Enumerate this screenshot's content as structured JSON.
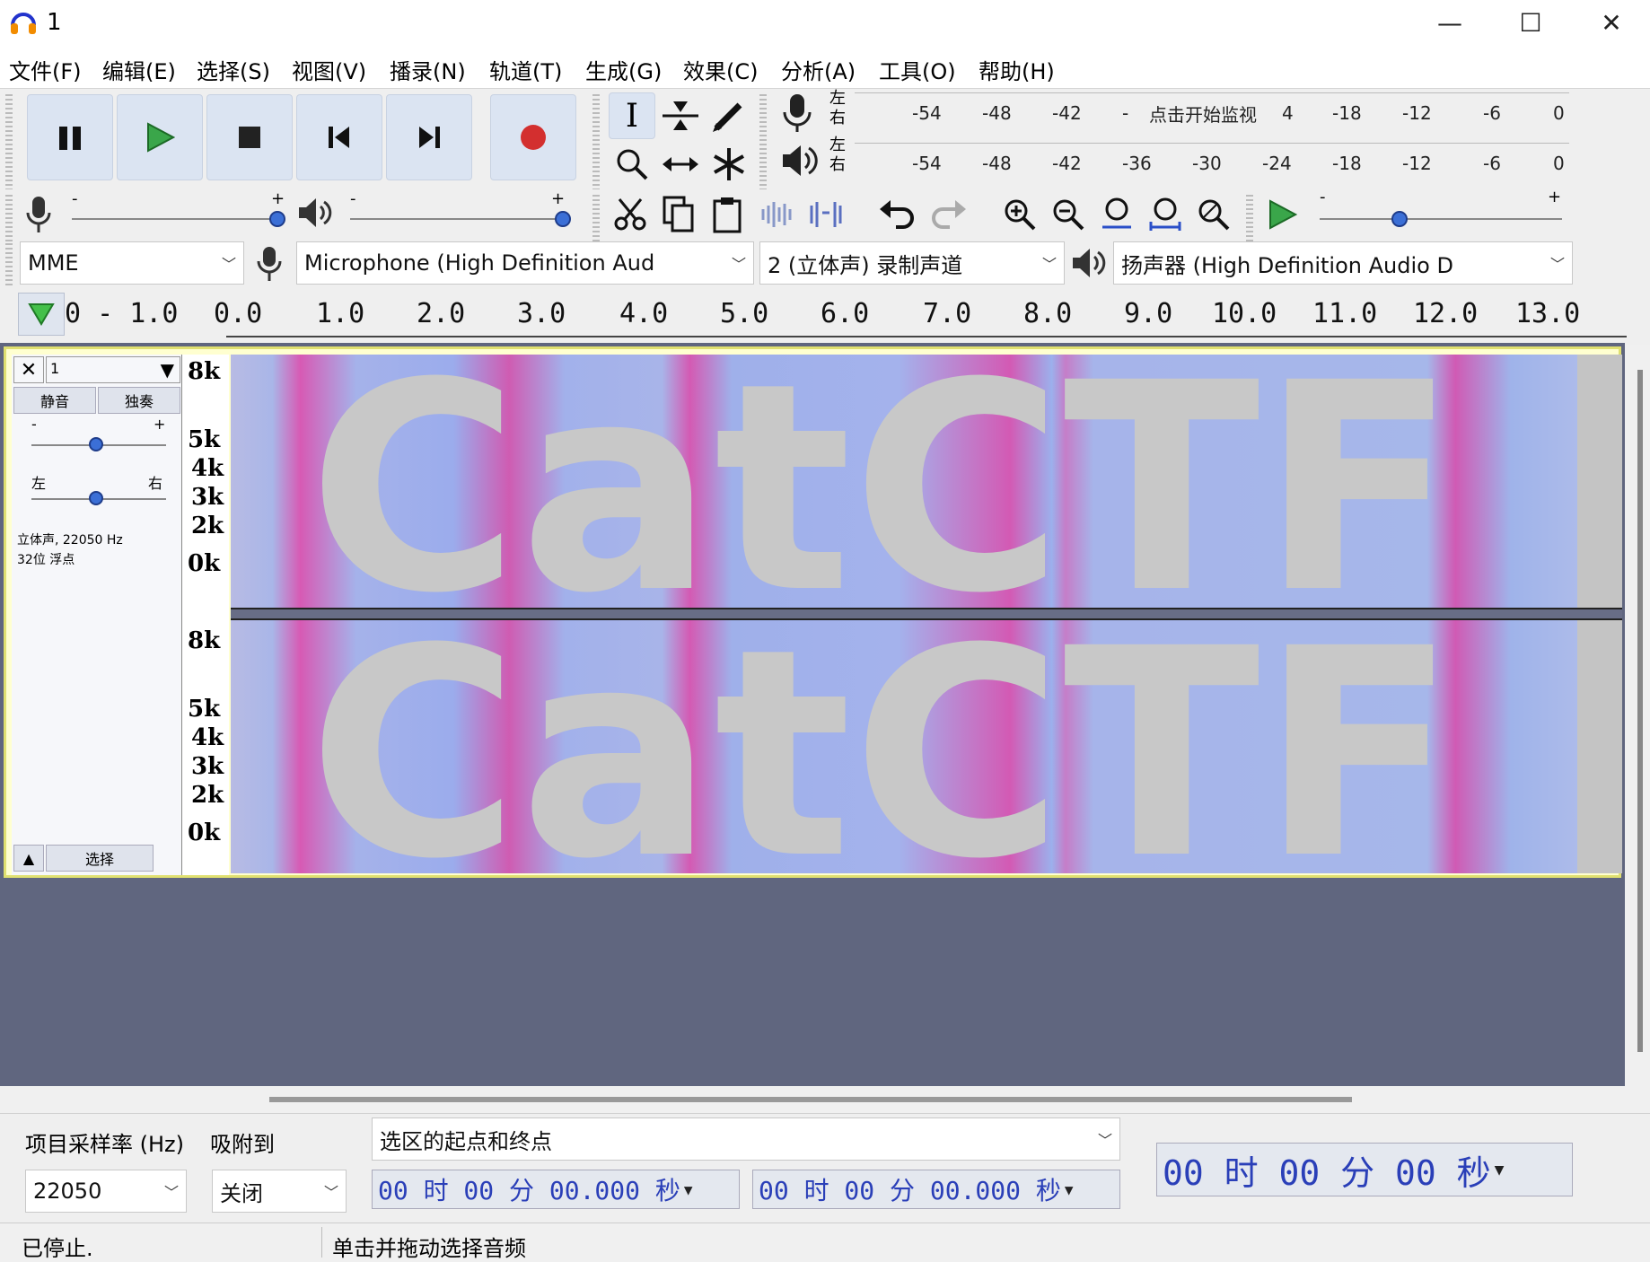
{
  "window": {
    "title": "1",
    "min": "—",
    "max": "☐",
    "close": "✕"
  },
  "menu": [
    {
      "label": "文件(F)"
    },
    {
      "label": "编辑(E)"
    },
    {
      "label": "选择(S)"
    },
    {
      "label": "视图(V)"
    },
    {
      "label": "播录(N)"
    },
    {
      "label": "轨道(T)"
    },
    {
      "label": "生成(G)"
    },
    {
      "label": "效果(C)"
    },
    {
      "label": "分析(A)"
    },
    {
      "label": "工具(O)"
    },
    {
      "label": "帮助(H)"
    }
  ],
  "meter": {
    "lr_left": "左",
    "lr_right": "右",
    "record_ticks": [
      "-54",
      "-48",
      "-42",
      "-",
      "点击开始监视",
      "4",
      "-18",
      "-12",
      "-6",
      "0"
    ],
    "play_ticks": [
      "-54",
      "-48",
      "-42",
      "-36",
      "-30",
      "-24",
      "-18",
      "-12",
      "-6",
      "0"
    ]
  },
  "sliders": {
    "minus": "-",
    "plus": "+"
  },
  "devices": {
    "host": "MME",
    "mic": "Microphone (High Definition Aud",
    "channels": "2 (立体声) 录制声道",
    "speaker": "扬声器 (High Definition Audio D"
  },
  "ruler": {
    "labels": [
      "0 - 1.0",
      "0.0",
      "1.0",
      "2.0",
      "3.0",
      "4.0",
      "5.0",
      "6.0",
      "7.0",
      "8.0",
      "9.0",
      "10.0",
      "11.0",
      "12.0",
      "13.0"
    ]
  },
  "track": {
    "name": "1",
    "mute": "静音",
    "solo": "独奏",
    "gain_minus": "-",
    "gain_plus": "+",
    "pan_left": "左",
    "pan_right": "右",
    "info_line1": "立体声, 22050 Hz",
    "info_line2": "32位 浮点",
    "select": "选择",
    "freq_labels": [
      "8k",
      "5k",
      "4k",
      "3k",
      "2k",
      "0k"
    ],
    "overlay_text": "CatCTF"
  },
  "bottom": {
    "rate_label": "项目采样率 (Hz)",
    "snap_label": "吸附到",
    "rate_value": "22050",
    "snap_value": "关闭",
    "selection_mode": "选区的起点和终点",
    "start_time": "00 时 00 分 00.000 秒",
    "end_time": "00 时 00 分 00.000 秒",
    "position": "00 时 00 分 00 秒"
  },
  "status": {
    "state": "已停止.",
    "hint": "单击并拖动选择音频"
  },
  "colors": {
    "accent": "#3b6fd6",
    "record": "#d32f2f",
    "play": "#3aa64a",
    "track_bg": "#60667f"
  }
}
